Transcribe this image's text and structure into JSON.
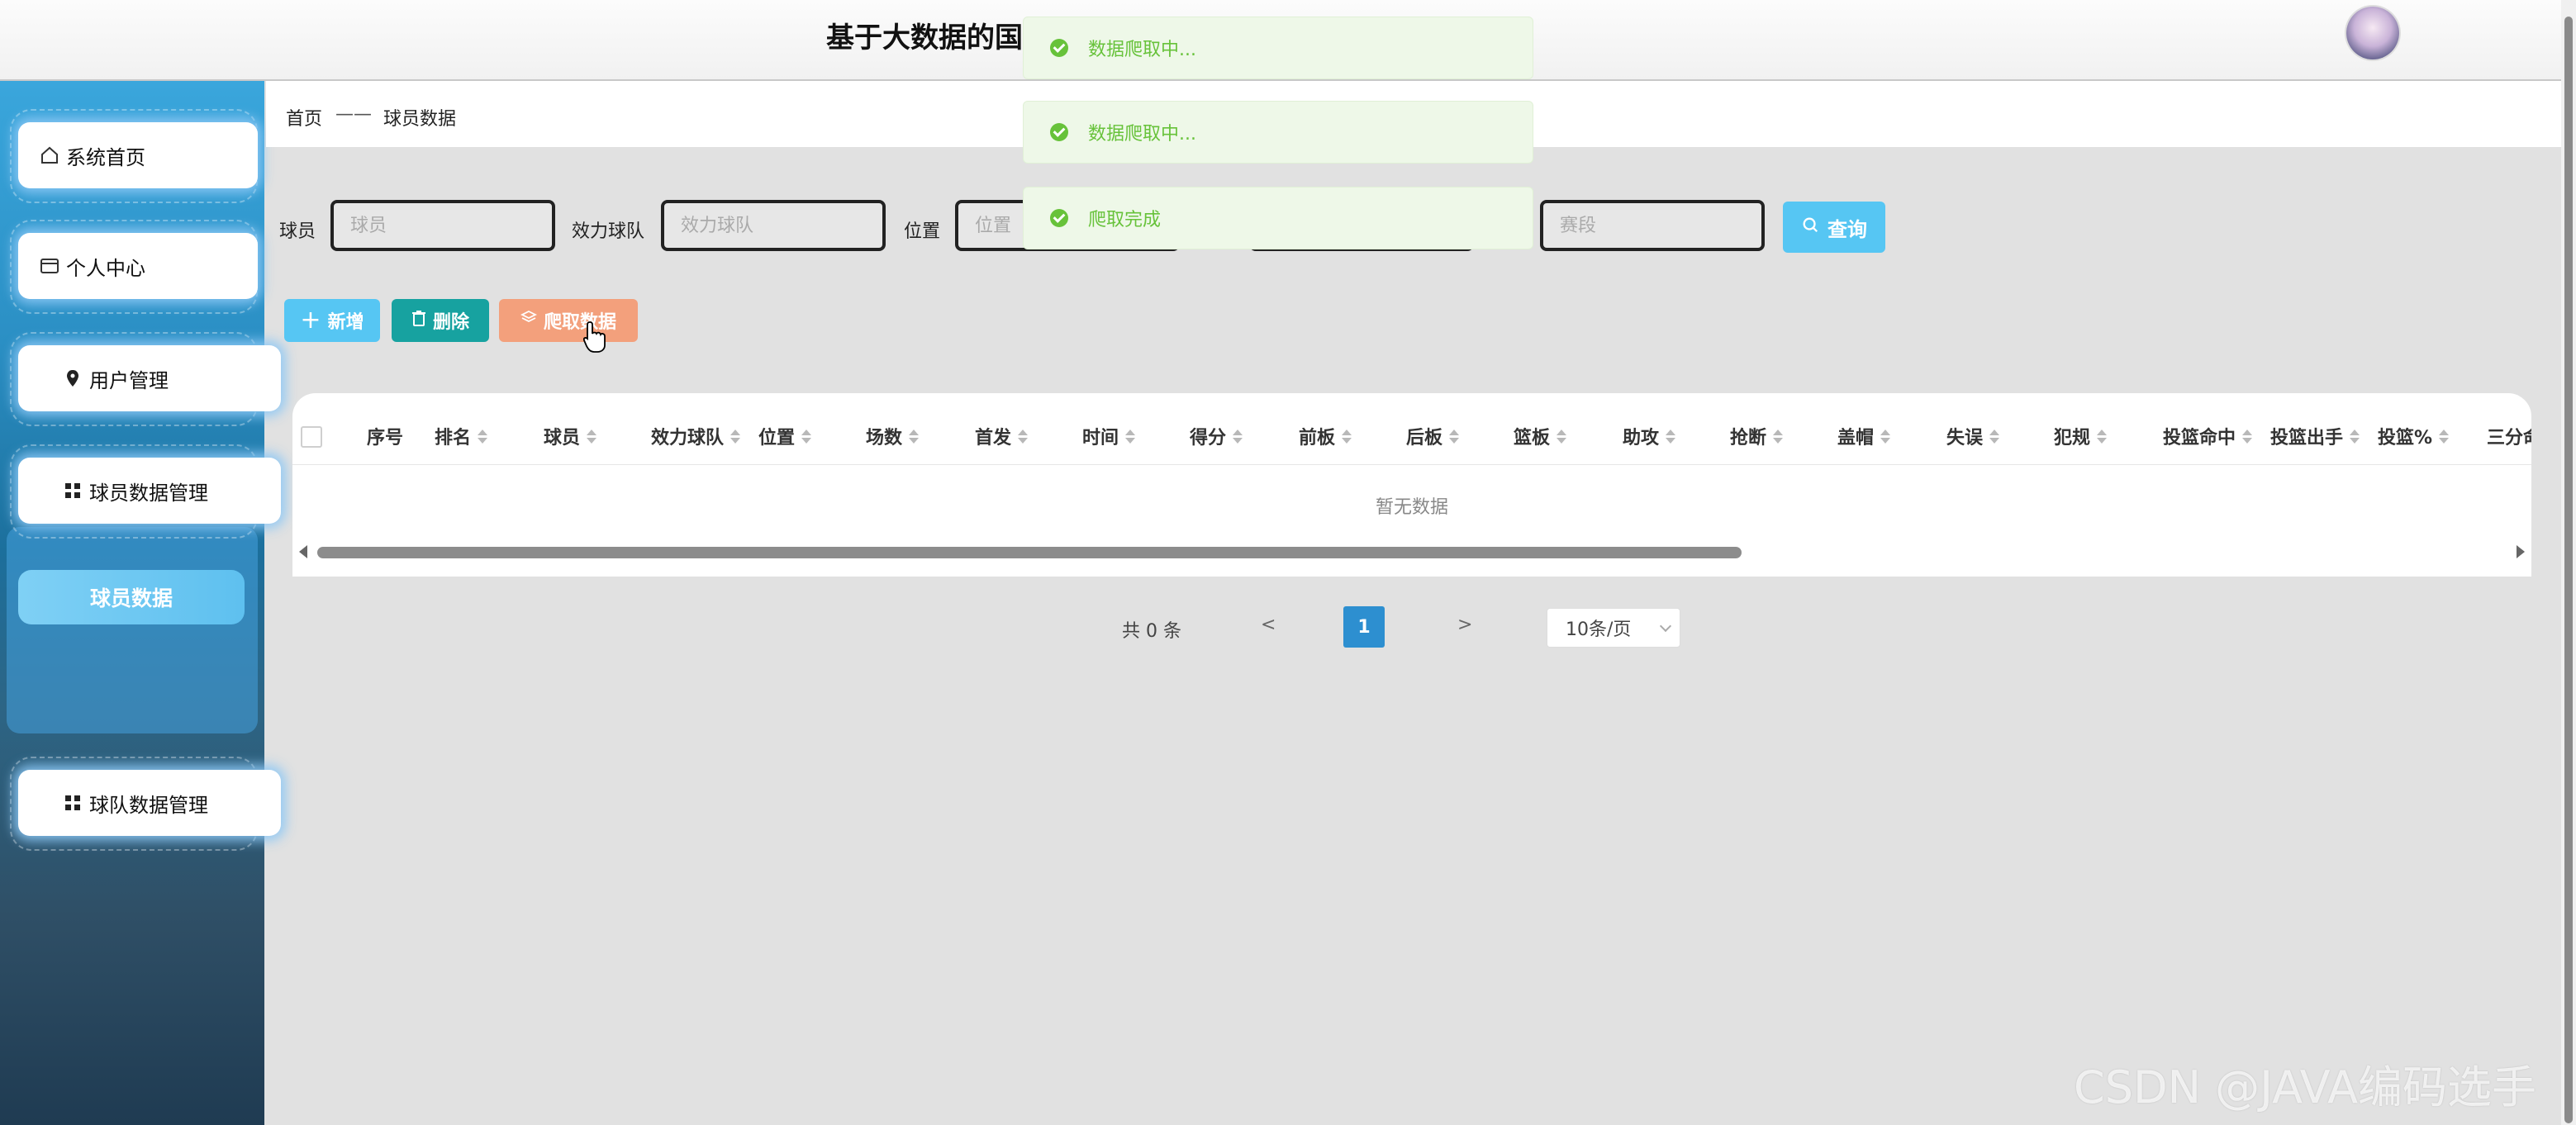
{
  "header": {
    "title": "基于大数据的国内篮球赛事球员数据分析系统设计与实现"
  },
  "sidebar": {
    "items": [
      {
        "label": "系统首页",
        "icon": "home-icon"
      },
      {
        "label": "个人中心",
        "icon": "id-card-icon"
      },
      {
        "label": "用户管理",
        "icon": "location-pin-icon"
      },
      {
        "label": "球员数据管理",
        "icon": "grid-icon"
      },
      {
        "label": "球队数据管理",
        "icon": "grid-icon"
      }
    ],
    "submenu": {
      "label": "球员数据"
    }
  },
  "breadcrumb": {
    "home": "首页",
    "separator": "——",
    "current": "球员数据"
  },
  "search": {
    "player_label": "球员",
    "player_placeholder": "球员",
    "team_label": "效力球队",
    "team_placeholder": "效力球队",
    "position_label": "位置",
    "position_placeholder": "位置",
    "season_placeholder": "赛段",
    "query_label": "查询"
  },
  "actions": {
    "add_label": "新增",
    "delete_label": "删除",
    "crawl_label": "爬取数据"
  },
  "table": {
    "columns": [
      "序号",
      "排名",
      "球员",
      "效力球队",
      "位置",
      "场数",
      "首发",
      "时间",
      "得分",
      "前板",
      "后板",
      "篮板",
      "助攻",
      "抢断",
      "盖帽",
      "失误",
      "犯规",
      "投篮命中",
      "投篮出手",
      "投篮%",
      "三分命"
    ],
    "empty_text": "暂无数据"
  },
  "pagination": {
    "total": "共 0 条",
    "prev": "<",
    "current": "1",
    "next": ">",
    "page_size": "10条/页"
  },
  "toasts": [
    {
      "text": "数据爬取中..."
    },
    {
      "text": "数据爬取中..."
    },
    {
      "text": "爬取完成"
    }
  ],
  "watermark": "CSDN @JAVA编码选手",
  "colors": {
    "query_button": "#56c6f3",
    "add_button": "#56c6f3",
    "delete_button": "#17a2a0",
    "crawl_button": "#f3a07c",
    "page_active": "#2d8fd0",
    "toast_success": "#67c23a"
  }
}
